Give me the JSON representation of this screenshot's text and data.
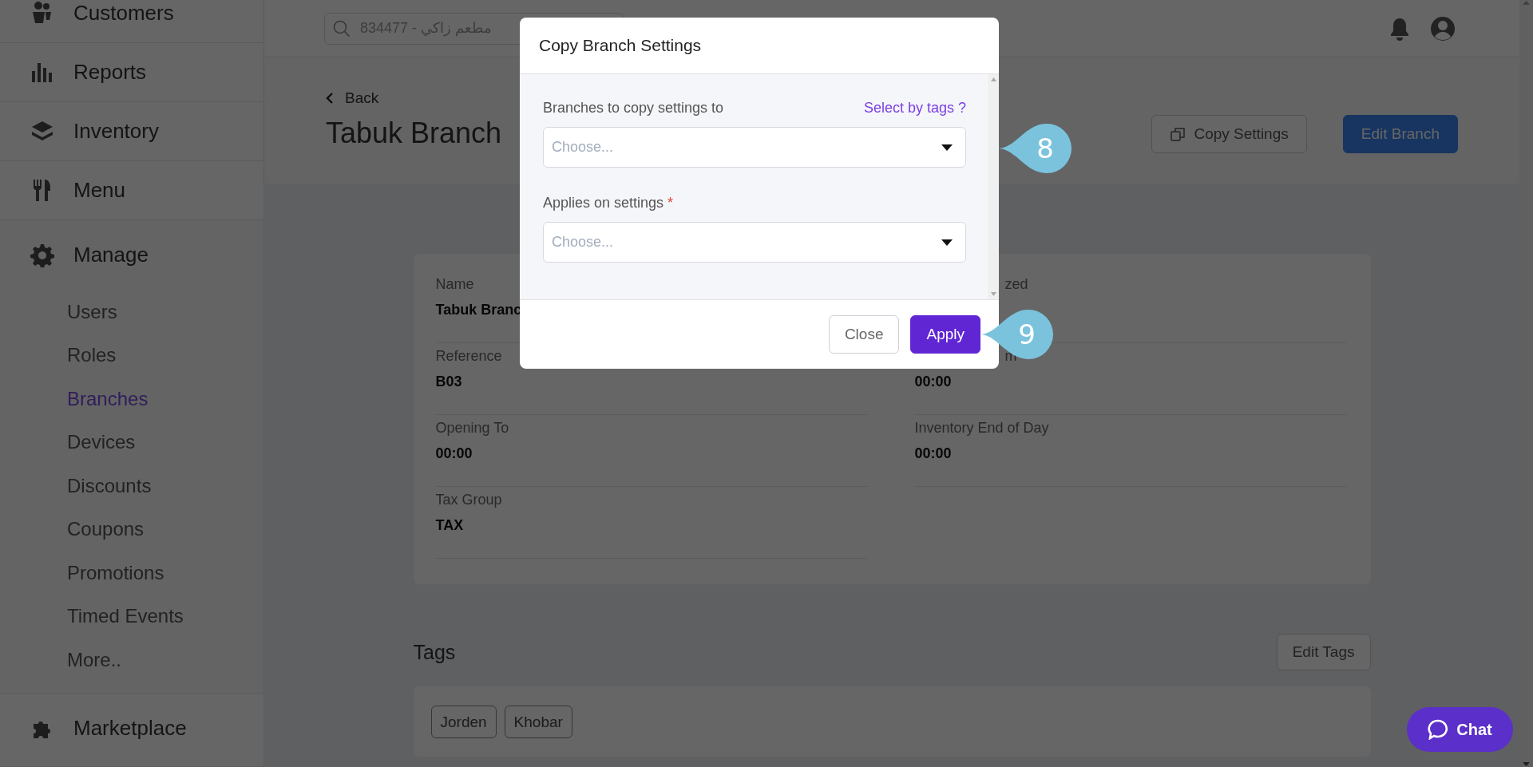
{
  "sidebar": {
    "items": [
      {
        "label": "Customers",
        "kind": "section"
      },
      {
        "label": "Reports",
        "kind": "section"
      },
      {
        "label": "Inventory",
        "kind": "section"
      },
      {
        "label": "Menu",
        "kind": "section"
      },
      {
        "label": "Manage",
        "kind": "group",
        "children": [
          {
            "label": "Users",
            "selected": false
          },
          {
            "label": "Roles",
            "selected": false
          },
          {
            "label": "Branches",
            "selected": true
          },
          {
            "label": "Devices",
            "selected": false
          },
          {
            "label": "Discounts",
            "selected": false
          },
          {
            "label": "Coupons",
            "selected": false
          },
          {
            "label": "Promotions",
            "selected": false
          },
          {
            "label": "Timed Events",
            "selected": false
          },
          {
            "label": "More..",
            "selected": false
          }
        ]
      },
      {
        "label": "Marketplace",
        "kind": "section"
      }
    ]
  },
  "header": {
    "search": {
      "placeholder": "834477 - مطعم زاكي"
    }
  },
  "page": {
    "back": "Back",
    "title": "Tabuk Branch",
    "buttons": [
      {
        "label": "Copy Settings",
        "kind": "outline"
      },
      {
        "label": "Edit Branch",
        "kind": "primary"
      }
    ]
  },
  "details": {
    "columns": [
      [
        {
          "label": "Name",
          "value": "Tabuk Branc",
          "partly_covered": false
        },
        {
          "label": "Reference",
          "value": "B03",
          "partly_covered": false
        },
        {
          "label": "Opening To",
          "value": "00:00",
          "partly_covered": false
        },
        {
          "label": "Tax Group",
          "value": "TAX",
          "partly_covered": false
        }
      ],
      [
        {
          "label": "zed",
          "partly_covered": true
        },
        {
          "label": "m",
          "value": "00:00",
          "partly_covered": true
        },
        {
          "label": "Inventory End of Day",
          "value": "00:00",
          "partly_covered": false
        }
      ]
    ]
  },
  "tags": {
    "title": "Tags",
    "edit": "Edit Tags",
    "items": [
      "Jorden",
      "Khobar"
    ]
  },
  "modal": {
    "title": "Copy Branch Settings",
    "fields": [
      {
        "label": "Branches to copy settings to",
        "link": "Select by tags ?",
        "required": false,
        "placeholder": "Choose..."
      },
      {
        "label": "Applies on settings",
        "required": true,
        "mark": "*",
        "placeholder": "Choose..."
      }
    ],
    "buttons": [
      {
        "label": "Close",
        "kind": "secondary"
      },
      {
        "label": "Apply",
        "kind": "primary"
      }
    ]
  },
  "callouts": [
    {
      "number": "8"
    },
    {
      "number": "9"
    }
  ],
  "chat": {
    "label": "Chat"
  }
}
